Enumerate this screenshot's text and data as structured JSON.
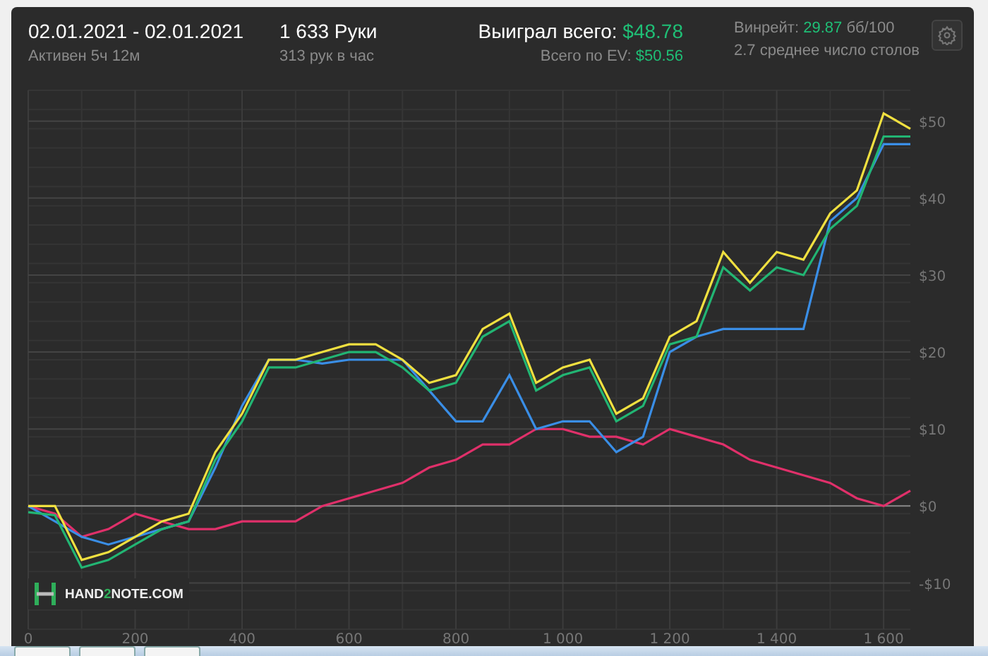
{
  "header": {
    "date_range": "02.01.2021 - 02.01.2021",
    "active": "Активен 5ч 12м",
    "hands": "1 633 Руки",
    "hands_per_hour": "313 рук в час",
    "won_label": "Выиграл всего:",
    "won_value": "$48.78",
    "ev_label": "Всего по EV:",
    "ev_value": "$50.56",
    "winrate_label": "Винрейт:",
    "winrate_value": "29.87",
    "winrate_unit": "бб/100",
    "tables": "2.7 среднее число столов"
  },
  "logo": {
    "prefix": "HAND",
    "accent": "2",
    "suffix": "NOTE.COM"
  },
  "chart_data": {
    "type": "line",
    "x": [
      0,
      50,
      100,
      150,
      200,
      250,
      300,
      350,
      400,
      450,
      500,
      550,
      600,
      650,
      700,
      750,
      800,
      850,
      900,
      950,
      1000,
      1050,
      1100,
      1150,
      1200,
      1250,
      1300,
      1350,
      1400,
      1450,
      1500,
      1550,
      1600,
      1650
    ],
    "series": [
      {
        "color": "#e0306a",
        "values": [
          0,
          -1,
          -4,
          -3,
          -1,
          -2,
          -3,
          -3,
          -2,
          -2,
          -2,
          0,
          1,
          2,
          3,
          5,
          6,
          8,
          8,
          10,
          10,
          9,
          9,
          8,
          10,
          9,
          8,
          6,
          5,
          4,
          3,
          1,
          0,
          2
        ]
      },
      {
        "color": "#3a8ee6",
        "values": [
          0,
          -2,
          -4,
          -5,
          -4,
          -3,
          -2,
          5,
          13,
          19,
          19,
          18.5,
          19,
          19,
          19,
          15,
          11,
          11,
          17,
          10,
          11,
          11,
          7,
          9,
          20,
          22,
          23,
          23,
          23,
          23,
          37,
          40,
          47,
          47
        ]
      },
      {
        "color": "#22b573",
        "values": [
          -0.8,
          -1.2,
          -8,
          -7,
          -5,
          -3,
          -2,
          6,
          11,
          18,
          18,
          19,
          20,
          20,
          18,
          15,
          16,
          22,
          24,
          15,
          17,
          18,
          11,
          13,
          21,
          22,
          31,
          28,
          31,
          30,
          36,
          39,
          48,
          48
        ]
      },
      {
        "color": "#f0e040",
        "values": [
          0,
          0,
          -7,
          -6,
          -4,
          -2,
          -1,
          7,
          12,
          19,
          19,
          20,
          21,
          21,
          19,
          16,
          17,
          23,
          25,
          16,
          18,
          19,
          12,
          14,
          22,
          24,
          33,
          29,
          33,
          32,
          38,
          41,
          51,
          49
        ]
      }
    ],
    "grid": true,
    "xlim": [
      0,
      1650
    ],
    "ylim": [
      -16,
      54
    ],
    "xticks": [
      0,
      200,
      400,
      600,
      800,
      {
        "value": 1000,
        "label": "1 000"
      },
      {
        "value": 1200,
        "label": "1 200"
      },
      {
        "value": 1400,
        "label": "1 400"
      },
      {
        "value": 1600,
        "label": "1 600"
      }
    ],
    "yticks": [
      {
        "value": -10,
        "label": "-$10"
      },
      {
        "value": 0,
        "label": "$0"
      },
      {
        "value": 10,
        "label": "$10"
      },
      {
        "value": 20,
        "label": "$20"
      },
      {
        "value": 30,
        "label": "$30"
      },
      {
        "value": 40,
        "label": "$40"
      },
      {
        "value": 50,
        "label": "$50"
      }
    ]
  }
}
